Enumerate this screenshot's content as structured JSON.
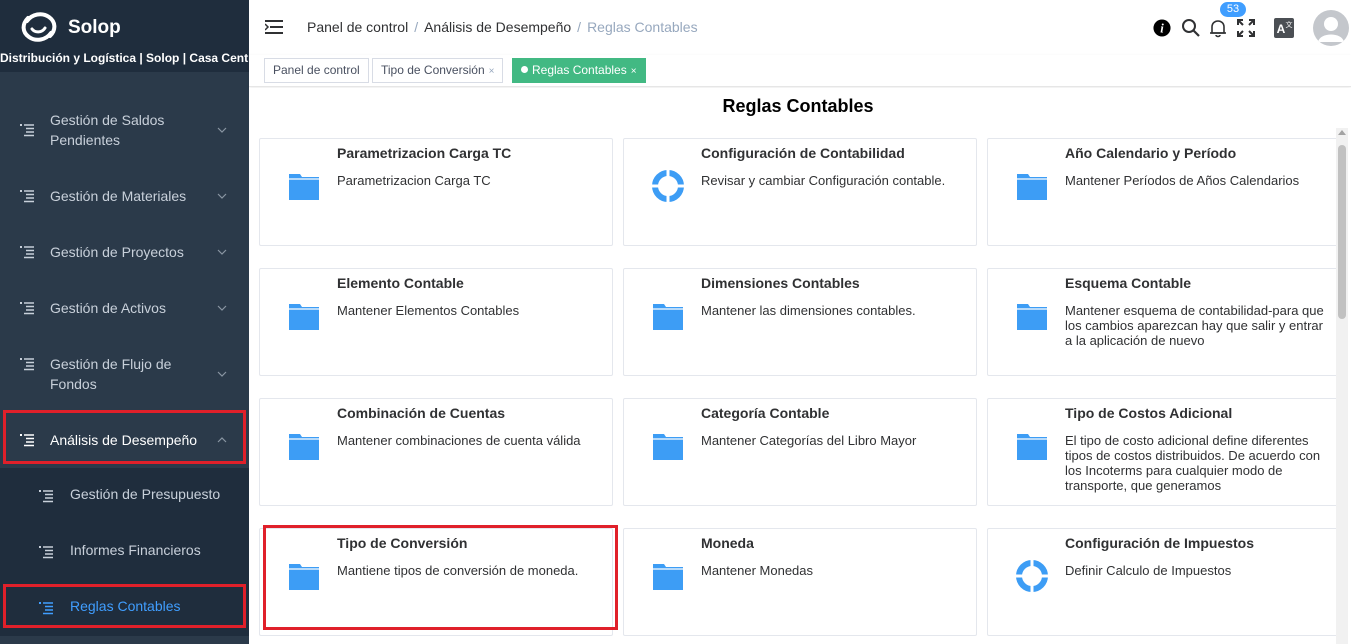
{
  "sidebar": {
    "brand": "Solop",
    "org": "Distribución y Logística | Solop | Casa Central",
    "items": [
      {
        "label": "Gestión de Saldos Pendientes"
      },
      {
        "label": "Gestión de Materiales"
      },
      {
        "label": "Gestión de Proyectos"
      },
      {
        "label": "Gestión de Activos"
      },
      {
        "label": "Gestión de Flujo de Fondos"
      },
      {
        "label": "Análisis de Desempeño"
      }
    ],
    "subitems": [
      {
        "label": "Gestión de Presupuesto"
      },
      {
        "label": "Informes Financieros"
      },
      {
        "label": "Reglas Contables"
      }
    ]
  },
  "header": {
    "breadcrumb": [
      "Panel de control",
      "Análisis de Desempeño",
      "Reglas Contables"
    ],
    "notifications": "53"
  },
  "tags": [
    {
      "label": "Panel de control"
    },
    {
      "label": "Tipo de Conversión",
      "close": "×"
    },
    {
      "label": "Reglas Contables",
      "close": "×"
    }
  ],
  "page": {
    "title": "Reglas Contables",
    "cards": [
      {
        "title": "Parametrizacion Carga TC",
        "desc": "Parametrizacion Carga TC",
        "icon": "folder-icon"
      },
      {
        "title": "Configuración de Contabilidad",
        "desc": "Revisar y cambiar Configuración contable.",
        "icon": "lifebuoy-icon"
      },
      {
        "title": "Año Calendario y Período",
        "desc": "Mantener Períodos de Años Calendarios",
        "icon": "folder-icon"
      },
      {
        "title": "Elemento Contable",
        "desc": "Mantener Elementos Contables",
        "icon": "folder-icon"
      },
      {
        "title": "Dimensiones Contables",
        "desc": "Mantener las dimensiones contables.",
        "icon": "folder-icon"
      },
      {
        "title": "Esquema Contable",
        "desc": "Mantener esquema de contabilidad-para que los cambios aparezcan hay que salir y entrar a la aplicación de nuevo",
        "icon": "folder-icon"
      },
      {
        "title": "Combinación de Cuentas",
        "desc": "Mantener combinaciones de cuenta válida",
        "icon": "folder-icon"
      },
      {
        "title": "Categoría Contable",
        "desc": "Mantener Categorías del Libro Mayor",
        "icon": "folder-icon"
      },
      {
        "title": "Tipo de Costos Adicional",
        "desc": "El tipo de costo adicional define diferentes tipos de costos distribuidos. De acuerdo con los Incoterms para cualquier modo de transporte, que generamos",
        "icon": "folder-icon"
      },
      {
        "title": "Tipo de Conversión",
        "desc": "Mantiene tipos de conversión de moneda.",
        "icon": "folder-icon"
      },
      {
        "title": "Moneda",
        "desc": "Mantener Monedas",
        "icon": "folder-icon"
      },
      {
        "title": "Configuración de Impuestos",
        "desc": "Definir Calculo de Impuestos",
        "icon": "lifebuoy-icon"
      }
    ]
  },
  "colors": {
    "sidebar": "#2b3a4a",
    "accent": "#409eff",
    "tag_active": "#42b983",
    "highlight": "#e0202a"
  }
}
